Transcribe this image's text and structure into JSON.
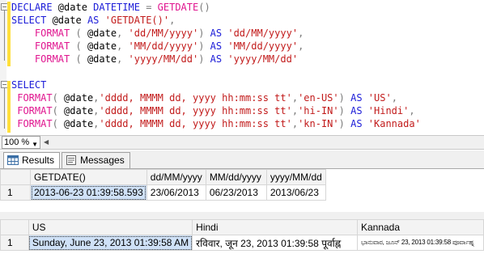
{
  "editor": {
    "lines": [
      [
        [
          "k",
          "DECLARE "
        ],
        [
          "n",
          "@date "
        ],
        [
          "k",
          "DATETIME "
        ],
        [
          "g",
          "= "
        ],
        [
          "f",
          "GETDATE"
        ],
        [
          "g",
          "()"
        ]
      ],
      [
        [
          "k",
          "SELECT "
        ],
        [
          "n",
          "@date "
        ],
        [
          "k",
          "AS "
        ],
        [
          "s",
          "'GETDATE()'"
        ],
        [
          "g",
          ","
        ]
      ],
      [
        [
          "n",
          "    "
        ],
        [
          "f",
          "FORMAT "
        ],
        [
          "g",
          "( "
        ],
        [
          "n",
          "@date"
        ],
        [
          "g",
          ", "
        ],
        [
          "s",
          "'dd/MM/yyyy'"
        ],
        [
          "g",
          ") "
        ],
        [
          "k",
          "AS "
        ],
        [
          "s",
          "'dd/MM/yyyy'"
        ],
        [
          "g",
          ","
        ]
      ],
      [
        [
          "n",
          "    "
        ],
        [
          "f",
          "FORMAT "
        ],
        [
          "g",
          "( "
        ],
        [
          "n",
          "@date"
        ],
        [
          "g",
          ", "
        ],
        [
          "s",
          "'MM/dd/yyyy'"
        ],
        [
          "g",
          ") "
        ],
        [
          "k",
          "AS "
        ],
        [
          "s",
          "'MM/dd/yyyy'"
        ],
        [
          "g",
          ","
        ]
      ],
      [
        [
          "n",
          "    "
        ],
        [
          "f",
          "FORMAT "
        ],
        [
          "g",
          "( "
        ],
        [
          "n",
          "@date"
        ],
        [
          "g",
          ", "
        ],
        [
          "s",
          "'yyyy/MM/dd'"
        ],
        [
          "g",
          ") "
        ],
        [
          "k",
          "AS "
        ],
        [
          "s",
          "'yyyy/MM/dd'"
        ]
      ],
      [],
      [
        [
          "k",
          "SELECT"
        ]
      ],
      [
        [
          "n",
          " "
        ],
        [
          "f",
          "FORMAT"
        ],
        [
          "g",
          "( "
        ],
        [
          "n",
          "@date"
        ],
        [
          "g",
          ","
        ],
        [
          "s",
          "'dddd, MMMM dd, yyyy hh:mm:ss tt'"
        ],
        [
          "g",
          ","
        ],
        [
          "s",
          "'en-US'"
        ],
        [
          "g",
          ") "
        ],
        [
          "k",
          "AS "
        ],
        [
          "s",
          "'US'"
        ],
        [
          "g",
          ","
        ]
      ],
      [
        [
          "n",
          " "
        ],
        [
          "f",
          "FORMAT"
        ],
        [
          "g",
          "( "
        ],
        [
          "n",
          "@date"
        ],
        [
          "g",
          ","
        ],
        [
          "s",
          "'dddd, MMMM dd, yyyy hh:mm:ss tt'"
        ],
        [
          "g",
          ","
        ],
        [
          "s",
          "'hi-IN'"
        ],
        [
          "g",
          ") "
        ],
        [
          "k",
          "AS "
        ],
        [
          "s",
          "'Hindi'"
        ],
        [
          "g",
          ","
        ]
      ],
      [
        [
          "n",
          " "
        ],
        [
          "f",
          "FORMAT"
        ],
        [
          "g",
          "( "
        ],
        [
          "n",
          "@date"
        ],
        [
          "g",
          ","
        ],
        [
          "s",
          "'dddd, MMMM dd, yyyy hh:mm:ss tt'"
        ],
        [
          "g",
          ","
        ],
        [
          "s",
          "'kn-IN'"
        ],
        [
          "g",
          ") "
        ],
        [
          "k",
          "AS "
        ],
        [
          "s",
          "'Kannada'"
        ]
      ]
    ]
  },
  "status": {
    "zoom": "100 %"
  },
  "tabs": [
    {
      "label": "Results",
      "icon": "grid-icon",
      "active": true
    },
    {
      "label": "Messages",
      "icon": "messages-icon",
      "active": false
    }
  ],
  "result1": {
    "columns": [
      "GETDATE()",
      "dd/MM/yyyy",
      "MM/dd/yyyy",
      "yyyy/MM/dd"
    ],
    "rows": [
      {
        "num": "1",
        "cells": [
          "2013-06-23 01:39:58.593",
          "23/06/2013",
          "06/23/2013",
          "2013/06/23"
        ]
      }
    ]
  },
  "result2": {
    "columns": [
      "US",
      "Hindi",
      "Kannada"
    ],
    "rows": [
      {
        "num": "1",
        "cells": [
          "Sunday, June 23, 2013 01:39:58 AM",
          "रविवार, जून 23, 2013 01:39:58 पूर्वाह्न",
          "ಭಾನುವಾರ, ಜೂನ್ 23, 2013 01:39:58 ಪೂರ್ವಾಹ್ನ"
        ]
      }
    ]
  },
  "colors": {
    "keyword": "#1c1cd8",
    "function": "#e0158f",
    "string": "#c21b1b",
    "operator": "#7a7a7a",
    "selected_cell": "#cfe1f7"
  }
}
